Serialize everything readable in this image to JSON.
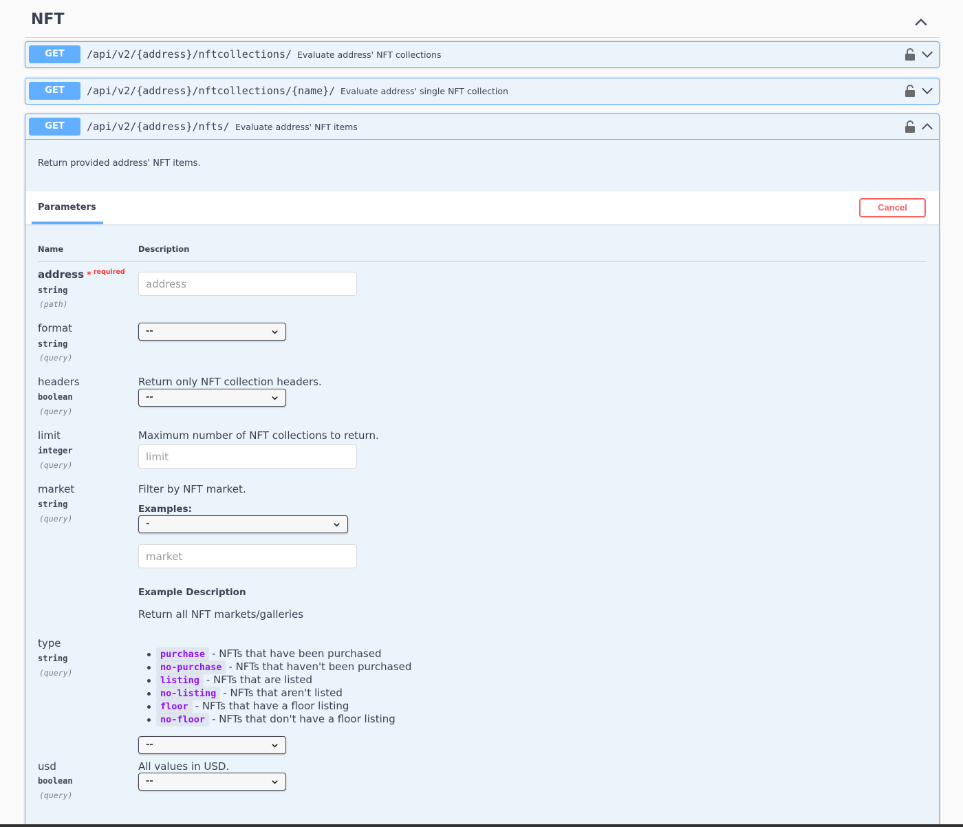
{
  "tag": {
    "title": "NFT"
  },
  "operations": [
    {
      "method": "GET",
      "path": "/api/v2/{address}/nftcollections/",
      "summary": "Evaluate address' NFT collections"
    },
    {
      "method": "GET",
      "path": "/api/v2/{address}/nftcollections/{name}/",
      "summary": "Evaluate address' single NFT collection"
    },
    {
      "method": "GET",
      "path": "/api/v2/{address}/nfts/",
      "summary": "Evaluate address' NFT items"
    }
  ],
  "expanded": {
    "description": "Return provided address' NFT items.",
    "parameters_tab": "Parameters",
    "cancel_label": "Cancel",
    "col_name": "Name",
    "col_description": "Description",
    "params": {
      "address": {
        "name": "address",
        "required_star": "*",
        "required_text": "required",
        "type": "string",
        "in": "(path)",
        "placeholder": "address"
      },
      "format": {
        "name": "format",
        "type": "string",
        "in": "(query)",
        "select_value": "--"
      },
      "headers": {
        "name": "headers",
        "type": "boolean",
        "in": "(query)",
        "description": "Return only NFT collection headers.",
        "select_value": "--"
      },
      "limit": {
        "name": "limit",
        "type": "integer",
        "in": "(query)",
        "description": "Maximum number of NFT collections to return.",
        "placeholder": "limit"
      },
      "market": {
        "name": "market",
        "type": "string",
        "in": "(query)",
        "description": "Filter by NFT market.",
        "examples_label": "Examples:",
        "examples_value": "-",
        "placeholder": "market",
        "example_desc_title": "Example Description",
        "example_desc": "Return all NFT markets/galleries"
      },
      "type": {
        "name": "type",
        "type": "string",
        "in": "(query)",
        "select_value": "--",
        "enum": [
          {
            "code": "purchase",
            "text": "- NFTs that have been purchased"
          },
          {
            "code": "no-purchase",
            "text": "- NFTs that haven't been purchased"
          },
          {
            "code": "listing",
            "text": "- NFTs that are listed"
          },
          {
            "code": "no-listing",
            "text": "- NFTs that aren't listed"
          },
          {
            "code": "floor",
            "text": "- NFTs that have a floor listing"
          },
          {
            "code": "no-floor",
            "text": "- NFTs that don't have a floor listing"
          }
        ]
      },
      "usd": {
        "name": "usd",
        "type": "boolean",
        "in": "(query)",
        "description": "All values in USD.",
        "select_value": "--"
      }
    }
  },
  "colors": {
    "get": "#61affe",
    "cancel": "#ff6060",
    "required": "#ff3333",
    "code": "#9012fe"
  }
}
